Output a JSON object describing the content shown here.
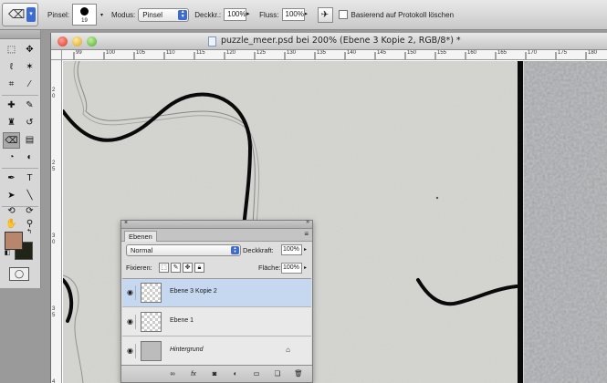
{
  "options_bar": {
    "brush_label": "Pinsel:",
    "brush_size": "19",
    "mode_label": "Modus:",
    "mode_value": "Pinsel",
    "opacity_label": "Deckkr.:",
    "opacity_value": "100%",
    "flow_label": "Fluss:",
    "flow_value": "100%",
    "erase_history_label": "Basierend auf Protokoll löschen"
  },
  "tools": {
    "foreground_color": "#b8866d",
    "background_color": "#202416"
  },
  "document": {
    "title": "puzzle_meer.psd bei 200% (Ebene 3 Kopie 2, RGB/8*) *",
    "ruler_h": [
      "99",
      "100",
      "105",
      "110",
      "115",
      "120",
      "125",
      "130",
      "135",
      "140",
      "145",
      "150",
      "155",
      "160",
      "165",
      "170",
      "175",
      "180",
      "185",
      "190",
      "195",
      "200"
    ],
    "ruler_v": [
      "2",
      "0",
      "2",
      "5",
      "3",
      "0",
      "3",
      "5",
      "4",
      "0"
    ]
  },
  "layers_panel": {
    "tab": "Ebenen",
    "blend_mode": "Normal",
    "opacity_label": "Deckkraft:",
    "opacity_value": "100%",
    "lock_label": "Fixieren:",
    "fill_label": "Fläche:",
    "fill_value": "100%",
    "layers": [
      {
        "name": "Ebene 3 Kopie 2",
        "selected": true
      },
      {
        "name": "Ebene 1",
        "selected": false
      },
      {
        "name": "Hintergrund",
        "selected": false,
        "locked": true
      }
    ],
    "bottom_buttons": [
      "link-icon",
      "fx-icon",
      "mask-icon",
      "adjustment-icon",
      "group-icon",
      "new-layer-icon",
      "trash-icon"
    ]
  }
}
